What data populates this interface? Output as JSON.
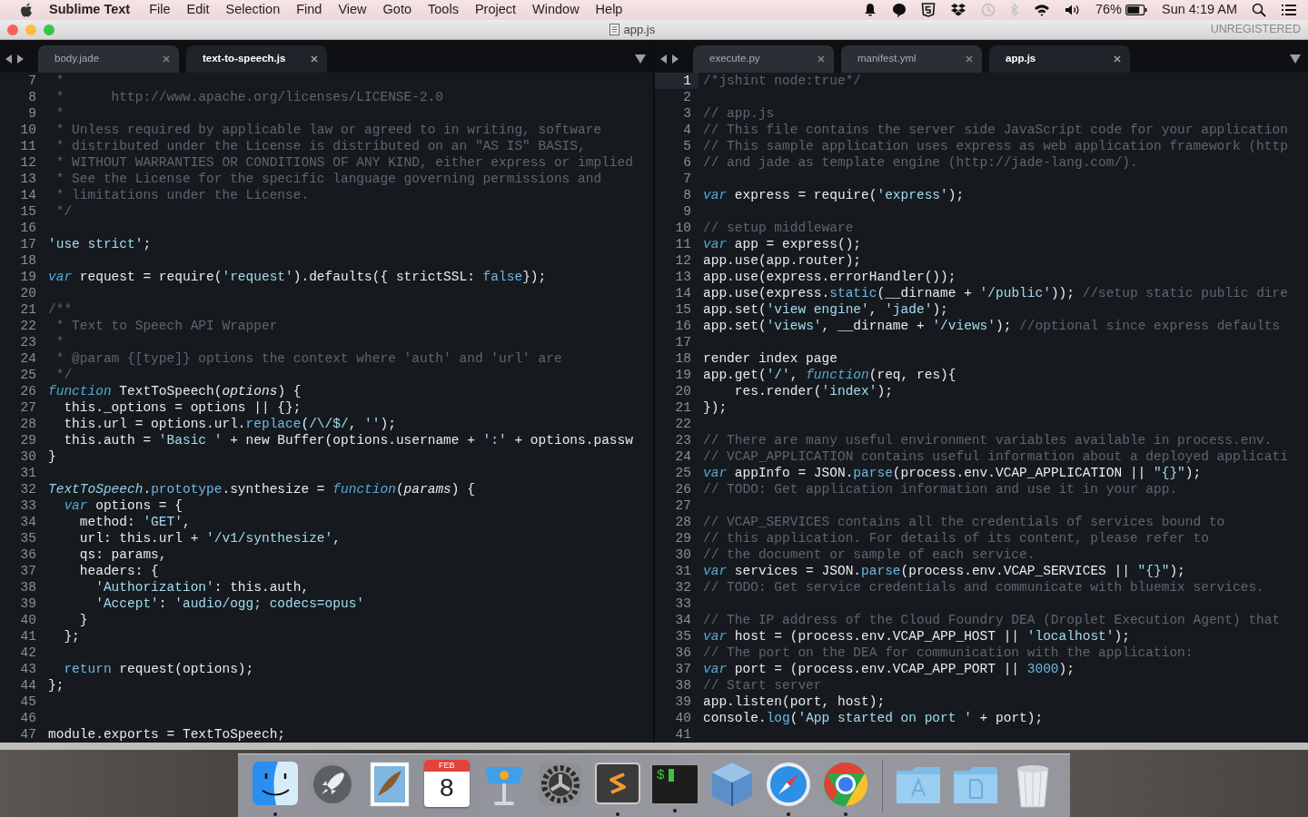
{
  "menubar": {
    "app_name": "Sublime Text",
    "menus": [
      "File",
      "Edit",
      "Selection",
      "Find",
      "View",
      "Goto",
      "Tools",
      "Project",
      "Window",
      "Help"
    ],
    "battery": "76%",
    "clock": "Sun 4:19 AM"
  },
  "window": {
    "title": "app.js",
    "license": "UNREGISTERED"
  },
  "panes": [
    {
      "tabs": [
        {
          "label": "body.jade",
          "selected": false
        },
        {
          "label": "text-to-speech.js",
          "selected": true
        }
      ],
      "lines": [
        {
          "number": "7",
          "current": false,
          "tokens": [
            {
              "kind": "comment",
              "text": " *"
            }
          ]
        },
        {
          "number": "8",
          "current": false,
          "tokens": [
            {
              "kind": "comment",
              "text": " *      http://www.apache.org/licenses/LICENSE-2.0"
            }
          ]
        },
        {
          "number": "9",
          "current": false,
          "tokens": [
            {
              "kind": "comment",
              "text": " *"
            }
          ]
        },
        {
          "number": "10",
          "current": false,
          "tokens": [
            {
              "kind": "comment",
              "text": " * Unless required by applicable law or agreed to in writing, software"
            }
          ]
        },
        {
          "number": "11",
          "current": false,
          "tokens": [
            {
              "kind": "comment",
              "text": " * distributed under the License is distributed on an \"AS IS\" BASIS,"
            }
          ]
        },
        {
          "number": "12",
          "current": false,
          "tokens": [
            {
              "kind": "comment",
              "text": " * WITHOUT WARRANTIES OR CONDITIONS OF ANY KIND, either express or implied"
            }
          ]
        },
        {
          "number": "13",
          "current": false,
          "tokens": [
            {
              "kind": "comment",
              "text": " * See the License for the specific language governing permissions and"
            }
          ]
        },
        {
          "number": "14",
          "current": false,
          "tokens": [
            {
              "kind": "comment",
              "text": " * limitations under the License."
            }
          ]
        },
        {
          "number": "15",
          "current": false,
          "tokens": [
            {
              "kind": "comment",
              "text": " */"
            }
          ]
        },
        {
          "number": "16",
          "current": false
        },
        {
          "number": "17",
          "current": false,
          "tokens": [
            {
              "kind": "string",
              "text": "'use strict'"
            },
            {
              "kind": "plain",
              "text": ";"
            }
          ]
        },
        {
          "number": "18",
          "current": false
        },
        {
          "number": "19",
          "current": false,
          "tokens": [
            {
              "kind": "keyword",
              "text": "var"
            },
            {
              "kind": "plain",
              "text": " request = require("
            },
            {
              "kind": "string",
              "text": "'request'"
            },
            {
              "kind": "plain",
              "text": ").defaults({ strictSSL: "
            },
            {
              "kind": "builtin",
              "text": "false"
            },
            {
              "kind": "plain",
              "text": "});"
            }
          ]
        },
        {
          "number": "20",
          "current": false
        },
        {
          "number": "21",
          "current": false,
          "tokens": [
            {
              "kind": "comment",
              "text": "/**"
            }
          ]
        },
        {
          "number": "22",
          "current": false,
          "tokens": [
            {
              "kind": "comment",
              "text": " * Text to Speech API Wrapper"
            }
          ]
        },
        {
          "number": "23",
          "current": false,
          "tokens": [
            {
              "kind": "comment",
              "text": " *"
            }
          ]
        },
        {
          "number": "24",
          "current": false,
          "tokens": [
            {
              "kind": "comment",
              "text": " * @param {[type]} options the context where 'auth' and 'url' are"
            }
          ]
        },
        {
          "number": "25",
          "current": false,
          "tokens": [
            {
              "kind": "comment",
              "text": " */"
            }
          ]
        },
        {
          "number": "26",
          "current": false,
          "tokens": [
            {
              "kind": "keyword",
              "text": "function"
            },
            {
              "kind": "plain",
              "text": " TextToSpeech("
            },
            {
              "kind": "param",
              "text": "options"
            },
            {
              "kind": "plain",
              "text": ") {"
            }
          ]
        },
        {
          "number": "27",
          "current": false,
          "tokens": [
            {
              "kind": "plain",
              "text": "  this._options = options || {};"
            }
          ]
        },
        {
          "number": "28",
          "current": false,
          "tokens": [
            {
              "kind": "plain",
              "text": "  this.url = options.url."
            },
            {
              "kind": "builtin",
              "text": "replace"
            },
            {
              "kind": "plain",
              "text": "("
            },
            {
              "kind": "string",
              "text": "/\\/$/"
            },
            {
              "kind": "plain",
              "text": ", "
            },
            {
              "kind": "string",
              "text": "''"
            },
            {
              "kind": "plain",
              "text": ");"
            }
          ]
        },
        {
          "number": "29",
          "current": false,
          "tokens": [
            {
              "kind": "plain",
              "text": "  this.auth = "
            },
            {
              "kind": "string",
              "text": "'Basic '"
            },
            {
              "kind": "plain",
              "text": " + new Buffer(options.username + "
            },
            {
              "kind": "string",
              "text": "':'"
            },
            {
              "kind": "plain",
              "text": " + options.passw"
            }
          ]
        },
        {
          "number": "30",
          "current": false,
          "tokens": [
            {
              "kind": "plain",
              "text": "}"
            }
          ]
        },
        {
          "number": "31",
          "current": false
        },
        {
          "number": "32",
          "current": false,
          "tokens": [
            {
              "kind": "classname",
              "text": "TextToSpeech"
            },
            {
              "kind": "plain",
              "text": "."
            },
            {
              "kind": "builtin",
              "text": "prototype"
            },
            {
              "kind": "plain",
              "text": ".synthesize = "
            },
            {
              "kind": "keyword",
              "text": "function"
            },
            {
              "kind": "plain",
              "text": "("
            },
            {
              "kind": "param",
              "text": "params"
            },
            {
              "kind": "plain",
              "text": ") {"
            }
          ]
        },
        {
          "number": "33",
          "current": false,
          "tokens": [
            {
              "kind": "keyword",
              "text": "  var"
            },
            {
              "kind": "plain",
              "text": " options = {"
            }
          ]
        },
        {
          "number": "34",
          "current": false,
          "tokens": [
            {
              "kind": "plain",
              "text": "    method: "
            },
            {
              "kind": "string",
              "text": "'GET'"
            },
            {
              "kind": "plain",
              "text": ","
            }
          ]
        },
        {
          "number": "35",
          "current": false,
          "tokens": [
            {
              "kind": "plain",
              "text": "    url: this.url + "
            },
            {
              "kind": "string",
              "text": "'/v1/synthesize'"
            },
            {
              "kind": "plain",
              "text": ","
            }
          ]
        },
        {
          "number": "36",
          "current": false,
          "tokens": [
            {
              "kind": "plain",
              "text": "    qs: params,"
            }
          ]
        },
        {
          "number": "37",
          "current": false,
          "tokens": [
            {
              "kind": "plain",
              "text": "    headers: {"
            }
          ]
        },
        {
          "number": "38",
          "current": false,
          "tokens": [
            {
              "kind": "string",
              "text": "      'Authorization'"
            },
            {
              "kind": "plain",
              "text": ": this.auth,"
            }
          ]
        },
        {
          "number": "39",
          "current": false,
          "tokens": [
            {
              "kind": "string",
              "text": "      'Accept'"
            },
            {
              "kind": "plain",
              "text": ": "
            },
            {
              "kind": "string",
              "text": "'audio/ogg; codecs=opus'"
            }
          ]
        },
        {
          "number": "40",
          "current": false,
          "tokens": [
            {
              "kind": "plain",
              "text": "    }"
            }
          ]
        },
        {
          "number": "41",
          "current": false,
          "tokens": [
            {
              "kind": "plain",
              "text": "  };"
            }
          ]
        },
        {
          "number": "42",
          "current": false
        },
        {
          "number": "43",
          "current": false,
          "tokens": [
            {
              "kind": "builtin",
              "text": "  return"
            },
            {
              "kind": "plain",
              "text": " request(options);"
            }
          ]
        },
        {
          "number": "44",
          "current": false,
          "tokens": [
            {
              "kind": "plain",
              "text": "};"
            }
          ]
        },
        {
          "number": "45",
          "current": false
        },
        {
          "number": "46",
          "current": false
        },
        {
          "number": "47",
          "current": false,
          "tokens": [
            {
              "kind": "plain",
              "text": "module.exports = TextToSpeech;"
            }
          ]
        }
      ]
    },
    {
      "tabs": [
        {
          "label": "execute.py",
          "selected": false
        },
        {
          "label": "manifest.yml",
          "selected": false
        },
        {
          "label": "app.js",
          "selected": true
        }
      ],
      "lines": [
        {
          "number": "1",
          "current": true,
          "tokens": [
            {
              "kind": "comment",
              "text": "/*jshint node:true*/"
            }
          ]
        },
        {
          "number": "2",
          "current": false
        },
        {
          "number": "3",
          "current": false,
          "tokens": [
            {
              "kind": "comment",
              "text": "// app.js"
            }
          ]
        },
        {
          "number": "4",
          "current": false,
          "tokens": [
            {
              "kind": "comment",
              "text": "// This file contains the server side JavaScript code for your application"
            }
          ]
        },
        {
          "number": "5",
          "current": false,
          "tokens": [
            {
              "kind": "comment",
              "text": "// This sample application uses express as web application framework (http"
            }
          ]
        },
        {
          "number": "6",
          "current": false,
          "tokens": [
            {
              "kind": "comment",
              "text": "// and jade as template engine (http://jade-lang.com/)."
            }
          ]
        },
        {
          "number": "7",
          "current": false
        },
        {
          "number": "8",
          "current": false,
          "tokens": [
            {
              "kind": "keyword",
              "text": "var"
            },
            {
              "kind": "plain",
              "text": " express = require("
            },
            {
              "kind": "string",
              "text": "'express'"
            },
            {
              "kind": "plain",
              "text": ");"
            }
          ]
        },
        {
          "number": "9",
          "current": false
        },
        {
          "number": "10",
          "current": false,
          "tokens": [
            {
              "kind": "comment",
              "text": "// setup middleware"
            }
          ]
        },
        {
          "number": "11",
          "current": false,
          "tokens": [
            {
              "kind": "keyword",
              "text": "var"
            },
            {
              "kind": "plain",
              "text": " app = express();"
            }
          ]
        },
        {
          "number": "12",
          "current": false,
          "tokens": [
            {
              "kind": "plain",
              "text": "app.use(app.router);"
            }
          ]
        },
        {
          "number": "13",
          "current": false,
          "tokens": [
            {
              "kind": "plain",
              "text": "app.use(express.errorHandler());"
            }
          ]
        },
        {
          "number": "14",
          "current": false,
          "tokens": [
            {
              "kind": "plain",
              "text": "app.use(express."
            },
            {
              "kind": "builtin",
              "text": "static"
            },
            {
              "kind": "plain",
              "text": "(__dirname + "
            },
            {
              "kind": "string",
              "text": "'/public'"
            },
            {
              "kind": "plain",
              "text": ")); "
            },
            {
              "kind": "comment",
              "text": "//setup static public dire"
            }
          ]
        },
        {
          "number": "15",
          "current": false,
          "tokens": [
            {
              "kind": "plain",
              "text": "app.set("
            },
            {
              "kind": "string",
              "text": "'view engine'"
            },
            {
              "kind": "plain",
              "text": ", "
            },
            {
              "kind": "string",
              "text": "'jade'"
            },
            {
              "kind": "plain",
              "text": ");"
            }
          ]
        },
        {
          "number": "16",
          "current": false,
          "tokens": [
            {
              "kind": "plain",
              "text": "app.set("
            },
            {
              "kind": "string",
              "text": "'views'"
            },
            {
              "kind": "plain",
              "text": ", __dirname + "
            },
            {
              "kind": "string",
              "text": "'/views'"
            },
            {
              "kind": "plain",
              "text": "); "
            },
            {
              "kind": "comment",
              "text": "//optional since express defaults"
            }
          ]
        },
        {
          "number": "17",
          "current": false
        },
        {
          "number": "18",
          "current": false,
          "tokens": [
            {
              "kind": "plain",
              "text": "render index page"
            }
          ]
        },
        {
          "number": "19",
          "current": false,
          "tokens": [
            {
              "kind": "plain",
              "text": "app.get("
            },
            {
              "kind": "string",
              "text": "'/'"
            },
            {
              "kind": "plain",
              "text": ", "
            },
            {
              "kind": "keyword",
              "text": "function"
            },
            {
              "kind": "plain",
              "text": "(req, res){"
            }
          ]
        },
        {
          "number": "20",
          "current": false,
          "tokens": [
            {
              "kind": "plain",
              "text": "    res.render("
            },
            {
              "kind": "string",
              "text": "'index'"
            },
            {
              "kind": "plain",
              "text": ");"
            }
          ]
        },
        {
          "number": "21",
          "current": false,
          "tokens": [
            {
              "kind": "plain",
              "text": "});"
            }
          ]
        },
        {
          "number": "22",
          "current": false
        },
        {
          "number": "23",
          "current": false,
          "tokens": [
            {
              "kind": "comment",
              "text": "// There are many useful environment variables available in process.env."
            }
          ]
        },
        {
          "number": "24",
          "current": false,
          "tokens": [
            {
              "kind": "comment",
              "text": "// VCAP_APPLICATION contains useful information about a deployed applicati"
            }
          ]
        },
        {
          "number": "25",
          "current": false,
          "tokens": [
            {
              "kind": "keyword",
              "text": "var"
            },
            {
              "kind": "plain",
              "text": " appInfo = JSON."
            },
            {
              "kind": "builtin",
              "text": "parse"
            },
            {
              "kind": "plain",
              "text": "(process.env.VCAP_APPLICATION || "
            },
            {
              "kind": "string",
              "text": "\"{}\""
            },
            {
              "kind": "plain",
              "text": ");"
            }
          ]
        },
        {
          "number": "26",
          "current": false,
          "tokens": [
            {
              "kind": "comment",
              "text": "// TODO: Get application information and use it in your app."
            }
          ]
        },
        {
          "number": "27",
          "current": false
        },
        {
          "number": "28",
          "current": false,
          "tokens": [
            {
              "kind": "comment",
              "text": "// VCAP_SERVICES contains all the credentials of services bound to"
            }
          ]
        },
        {
          "number": "29",
          "current": false,
          "tokens": [
            {
              "kind": "comment",
              "text": "// this application. For details of its content, please refer to"
            }
          ]
        },
        {
          "number": "30",
          "current": false,
          "tokens": [
            {
              "kind": "comment",
              "text": "// the document or sample of each service."
            }
          ]
        },
        {
          "number": "31",
          "current": false,
          "tokens": [
            {
              "kind": "keyword",
              "text": "var"
            },
            {
              "kind": "plain",
              "text": " services = JSON."
            },
            {
              "kind": "builtin",
              "text": "parse"
            },
            {
              "kind": "plain",
              "text": "(process.env.VCAP_SERVICES || "
            },
            {
              "kind": "string",
              "text": "\"{}\""
            },
            {
              "kind": "plain",
              "text": ");"
            }
          ]
        },
        {
          "number": "32",
          "current": false,
          "tokens": [
            {
              "kind": "comment",
              "text": "// TODO: Get service credentials and communicate with bluemix services."
            }
          ]
        },
        {
          "number": "33",
          "current": false
        },
        {
          "number": "34",
          "current": false,
          "tokens": [
            {
              "kind": "comment",
              "text": "// The IP address of the Cloud Foundry DEA (Droplet Execution Agent) that"
            }
          ]
        },
        {
          "number": "35",
          "current": false,
          "tokens": [
            {
              "kind": "keyword",
              "text": "var"
            },
            {
              "kind": "plain",
              "text": " host = (process.env.VCAP_APP_HOST || "
            },
            {
              "kind": "string",
              "text": "'localhost'"
            },
            {
              "kind": "plain",
              "text": ");"
            }
          ]
        },
        {
          "number": "36",
          "current": false,
          "tokens": [
            {
              "kind": "comment",
              "text": "// The port on the DEA for communication with the application:"
            }
          ]
        },
        {
          "number": "37",
          "current": false,
          "tokens": [
            {
              "kind": "keyword",
              "text": "var"
            },
            {
              "kind": "plain",
              "text": " port = (process.env.VCAP_APP_PORT || "
            },
            {
              "kind": "builtin",
              "text": "3000"
            },
            {
              "kind": "plain",
              "text": ");"
            }
          ]
        },
        {
          "number": "38",
          "current": false,
          "tokens": [
            {
              "kind": "comment",
              "text": "// Start server"
            }
          ]
        },
        {
          "number": "39",
          "current": false,
          "tokens": [
            {
              "kind": "plain",
              "text": "app.listen(port, host);"
            }
          ]
        },
        {
          "number": "40",
          "current": false,
          "tokens": [
            {
              "kind": "plain",
              "text": "console."
            },
            {
              "kind": "builtin",
              "text": "log"
            },
            {
              "kind": "plain",
              "text": "("
            },
            {
              "kind": "string",
              "text": "'App started on port '"
            },
            {
              "kind": "plain",
              "text": " + port);"
            }
          ]
        },
        {
          "number": "41",
          "current": false
        }
      ]
    }
  ],
  "dock": {
    "items": [
      {
        "kind": "finder",
        "running": true
      },
      {
        "kind": "launchpad",
        "running": false
      },
      {
        "kind": "mail",
        "running": false
      },
      {
        "kind": "calendar",
        "running": false,
        "month": "FEB",
        "day": "8"
      },
      {
        "kind": "keynote",
        "running": false
      },
      {
        "kind": "preferences",
        "running": false
      },
      {
        "kind": "sublime",
        "running": true
      },
      {
        "kind": "terminal",
        "running": true,
        "prompt": "$"
      },
      {
        "kind": "virtualbox",
        "running": false
      },
      {
        "kind": "safari",
        "running": true
      },
      {
        "kind": "chrome",
        "running": true
      },
      {
        "kind": "separator"
      },
      {
        "kind": "apps-folder",
        "running": false
      },
      {
        "kind": "docs-folder",
        "running": false
      },
      {
        "kind": "trash",
        "running": false
      }
    ]
  }
}
